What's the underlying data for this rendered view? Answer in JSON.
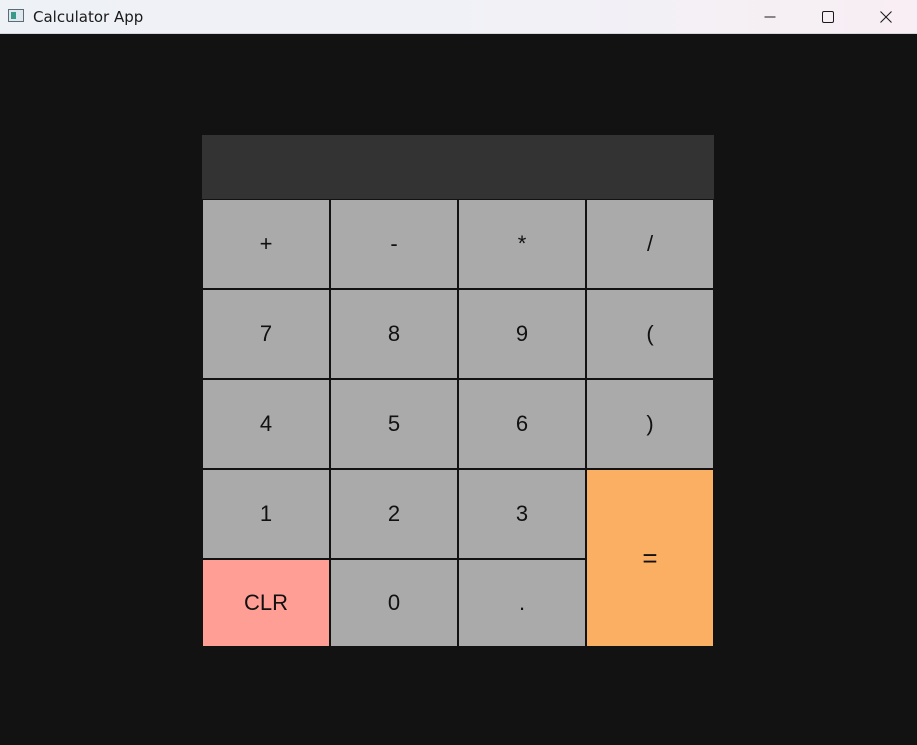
{
  "window": {
    "title": "Calculator App",
    "icons": {
      "app": "app-window-icon",
      "minimize": "minimize-icon",
      "maximize": "maximize-icon",
      "close": "close-icon"
    }
  },
  "display": {
    "value": ""
  },
  "keys": {
    "row1": [
      "+",
      "-",
      "*",
      "/"
    ],
    "row2": [
      "7",
      "8",
      "9",
      "("
    ],
    "row3": [
      "4",
      "5",
      "6",
      ")"
    ],
    "row4": [
      "1",
      "2",
      "3"
    ],
    "row5": [
      "CLR",
      "0",
      "."
    ],
    "equals": "="
  },
  "colors": {
    "background": "#121212",
    "display_bg": "#333333",
    "key_bg": "#aaaaaa",
    "clear_bg": "#ff9e94",
    "equals_bg": "#fbaf63"
  }
}
